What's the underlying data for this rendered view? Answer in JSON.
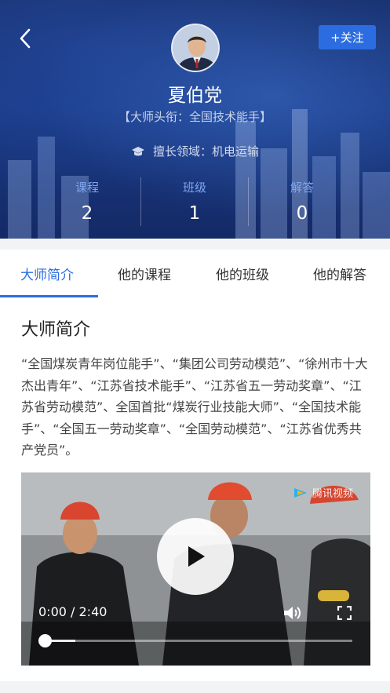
{
  "header": {
    "follow_label": "+关注",
    "name": "夏伯党",
    "title": "【大师头衔：全国技术能手】",
    "field": "擅长领域：机电运输"
  },
  "stats": [
    {
      "label": "课程",
      "value": "2"
    },
    {
      "label": "班级",
      "value": "1"
    },
    {
      "label": "解答",
      "value": "0"
    }
  ],
  "tabs": [
    {
      "label": "大师简介",
      "active": true
    },
    {
      "label": "他的课程"
    },
    {
      "label": "他的班级"
    },
    {
      "label": "他的解答"
    }
  ],
  "content": {
    "section_title": "大师简介",
    "intro": "“全国煤炭青年岗位能手”、“集团公司劳动模范”、“徐州市十大杰出青年”、“江苏省技术能手”、“江苏省五一劳动奖章”、“江苏省劳动模范”、全国首批“煤炭行业技能大师”、“全国技术能手”、“全国五一劳动奖章”、“全国劳动模范”、“江苏省优秀共产党员”。"
  },
  "video": {
    "watermark": "腾讯视频",
    "time": "0:00 / 2:40",
    "buffered_fraction": 0.1,
    "played_fraction": 0
  },
  "colors": {
    "accent": "#2b6de0",
    "header_bg": "#18306e"
  },
  "icons": [
    "back-arrow-icon",
    "graduation-cap-icon",
    "play-icon",
    "volume-icon",
    "fullscreen-icon",
    "tencent-video-logo-icon"
  ]
}
